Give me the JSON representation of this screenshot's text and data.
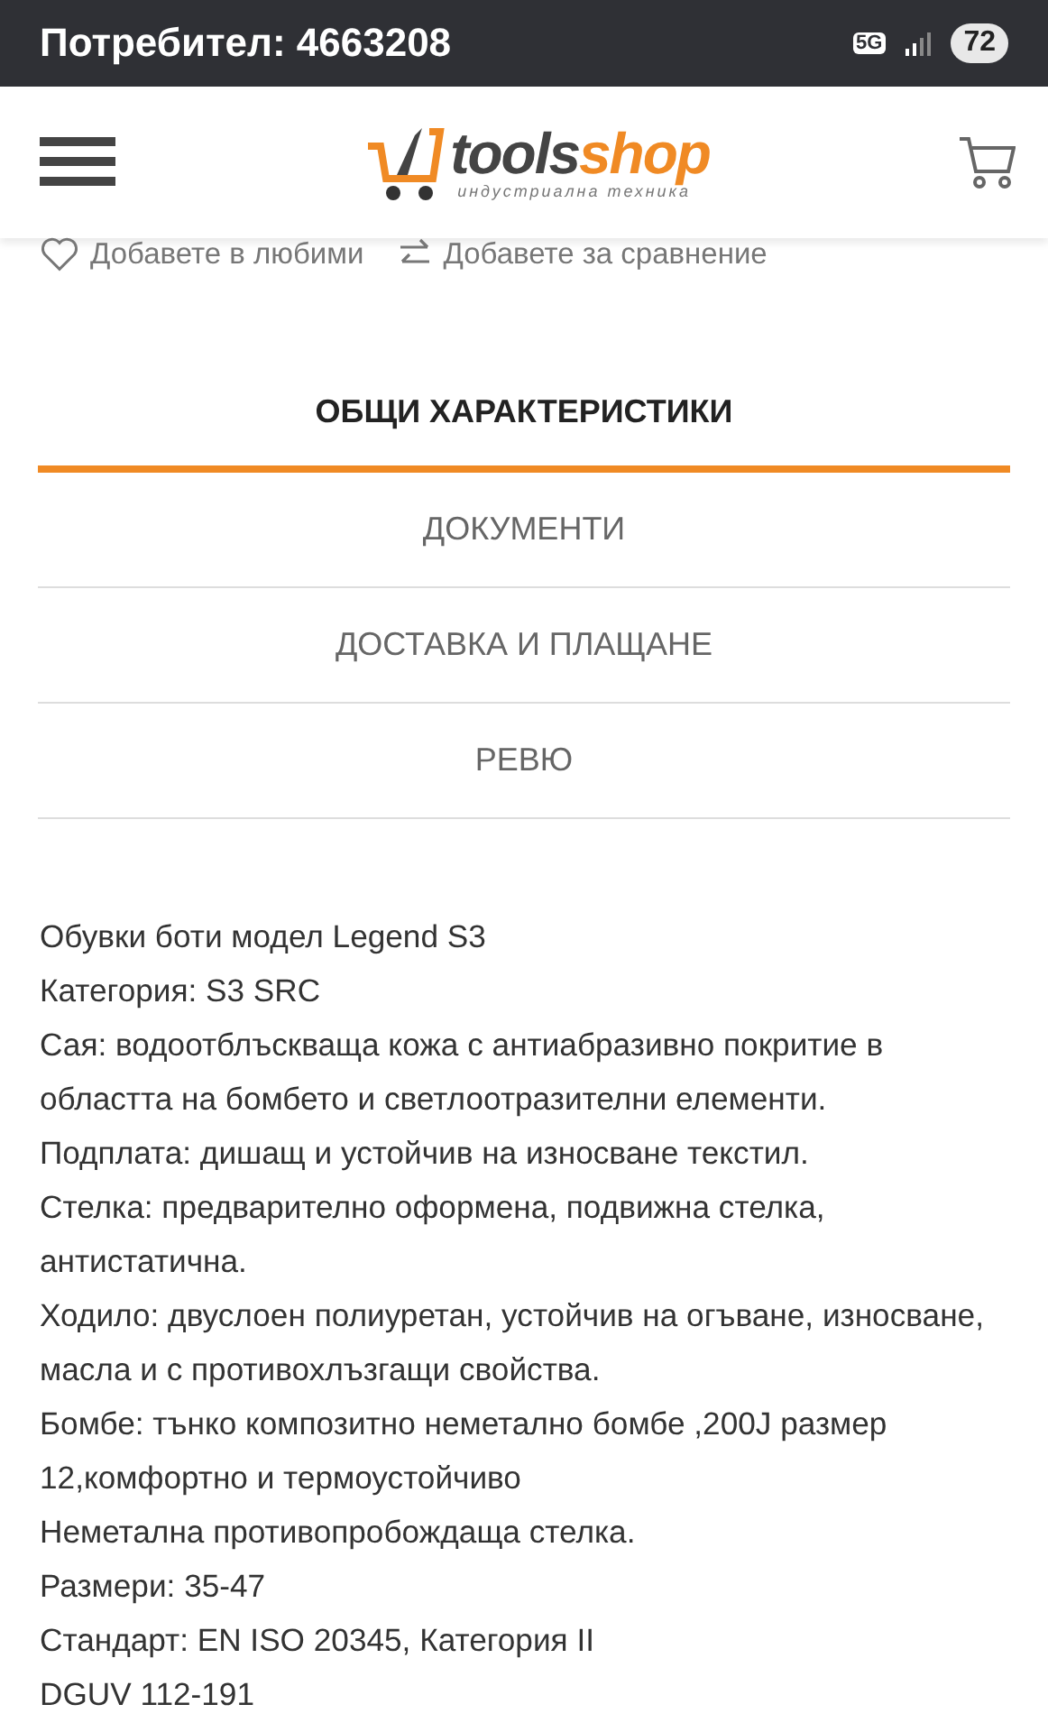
{
  "status_bar": {
    "text": "Потребител: 4663208",
    "network": "5G",
    "battery": "72"
  },
  "header": {
    "logo": {
      "word_dark": "tools",
      "word_accent": "shop",
      "tagline": "индустриална техника"
    }
  },
  "actions": [
    {
      "kind": "favorite",
      "label": "Добавете в любими"
    },
    {
      "kind": "compare",
      "label": "Добавете за сравнение"
    }
  ],
  "tabs": [
    {
      "label": "ОБЩИ ХАРАКТЕРИСТИКИ",
      "selected": true
    },
    {
      "label": "ДОКУМЕНТИ",
      "selected": false
    },
    {
      "label": "ДОСТАВКА И ПЛАЩАНЕ",
      "selected": false
    },
    {
      "label": "РЕВЮ",
      "selected": false
    }
  ],
  "description": [
    "Обувки боти модел Legend S3",
    "Категория: S3 SRC",
    "Сая: водоотблъскваща кожа с антиабразивно покритие в областта на бомбето и светлоотразителни елементи.",
    "Подплата: дишащ и устойчив на износване текстил.",
    "Стелка: предварително оформена, подвижна стелка, антистатична.",
    "Ходило: двуслоен полиуретан, устойчив на огъване, износване, масла и с противохлъзгащи свойства.",
    "Бомбе: тънко композитно неметално бомбе ,200J размер 12,комфортно и термоустойчиво",
    "Неметална противопробождаща стелка.",
    "Размери: 35-47",
    "Стандарт: EN ISO 20345, Категория II",
    "DGUV 112-191"
  ]
}
